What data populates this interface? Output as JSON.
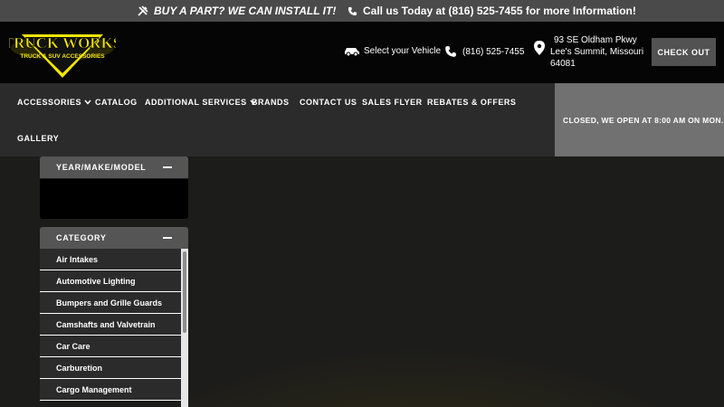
{
  "topbar": {
    "promo": "BUY A PART? WE CAN INSTALL IT!",
    "call": "Call us Today at (816) 525-7455 for more Information!"
  },
  "header": {
    "logo_icon": "truck-works-logo",
    "logo_line1": "TRUCK WORKS",
    "logo_line2": "TRUCK & SUV ACCESSORIES",
    "vehicle": "Select your Vehicle",
    "phone": "(816) 525-7455",
    "address": [
      "93 SE Oldham Pkwy",
      "Lee's Summit, Missouri",
      "64081"
    ],
    "checkout": "CHECK OUT"
  },
  "nav": {
    "items": [
      "ACCESSORIES",
      "CATALOG",
      "ADDITIONAL SERVICES",
      "BRANDS",
      "CONTACT US",
      "SALES FLYER",
      "REBATES & OFFERS",
      "GALLERY"
    ],
    "hours": "CLOSED, WE OPEN AT 8:00 AM ON MON."
  },
  "sidebar": {
    "ymm_title": "YEAR/MAKE/MODEL",
    "category_title": "CATEGORY",
    "categories": [
      "Air Intakes",
      "Automotive Lighting",
      "Bumpers and Grille Guards",
      "Camshafts and Valvetrain",
      "Car Care",
      "Carburetion",
      "Cargo Management"
    ]
  },
  "colors": {
    "topbar": "#4a4a4a",
    "header": "#050505",
    "nav": "#2b2b2b",
    "hours": "#717171",
    "accent": "#f2e600"
  }
}
